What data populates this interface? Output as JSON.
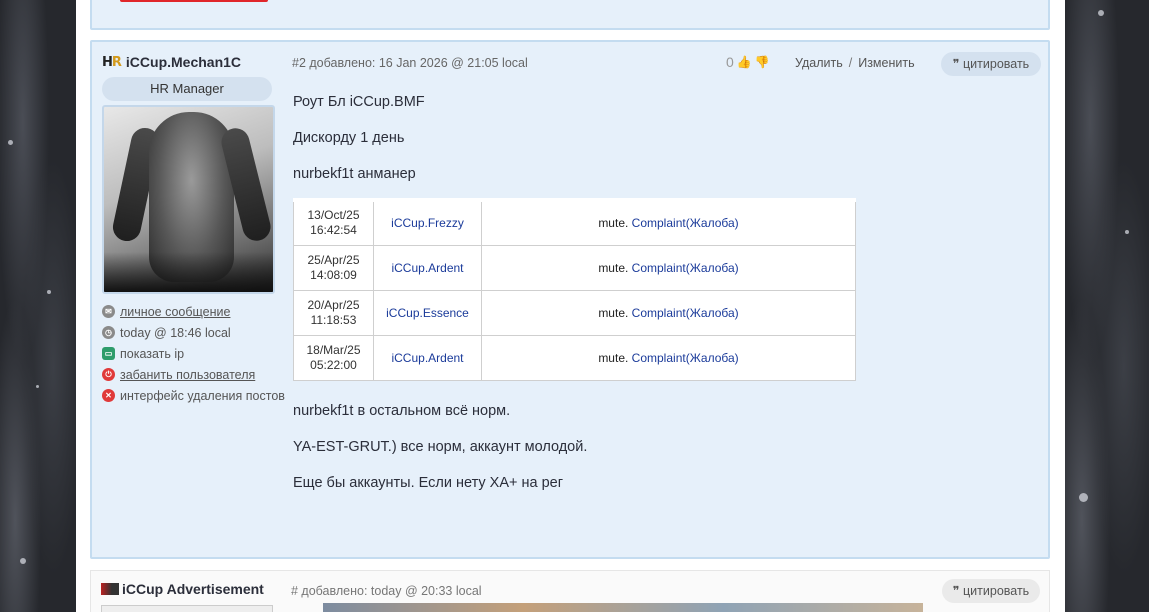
{
  "previous_post": {},
  "post": {
    "author": {
      "logo": "HR",
      "name": "iCCup.Mechan1C",
      "role": "HR Manager"
    },
    "actions": [
      {
        "icon": "envelope-icon",
        "label": "личное сообщение",
        "link": true,
        "color": "#8a8a8a"
      },
      {
        "icon": "clock-icon",
        "label": "today @ 18:46 local",
        "link": false,
        "color": "#8a8a8a"
      },
      {
        "icon": "monitor-icon",
        "label": "показать ip",
        "link": false,
        "color": "#2e9c6b"
      },
      {
        "icon": "power-icon",
        "label": "забанить пользователя",
        "link": true,
        "color": "#e03a3a"
      },
      {
        "icon": "close-circle-icon",
        "label": "интерфейс удаления постов",
        "link": false,
        "color": "#e03a3a"
      }
    ],
    "meta": "#2 добавлено: 16 Jan 2026 @ 21:05 local",
    "votes": "0",
    "admin": {
      "delete": "Удалить",
      "separator": "/",
      "edit": "Изменить"
    },
    "quote_label": "цитировать",
    "body_before": [
      "Роут Бл iCCup.BMF",
      "Дискорду 1 день",
      "nurbekf1t анманер"
    ],
    "log_table": [
      {
        "date": "13/Oct/25",
        "time": "16:42:54",
        "user": "iCCup.Frezzy",
        "reason": "mute.",
        "link": "Complaint(Жалоба)"
      },
      {
        "date": "25/Apr/25",
        "time": "14:08:09",
        "user": "iCCup.Ardent",
        "reason": "mute.",
        "link": "Complaint(Жалоба)"
      },
      {
        "date": "20/Apr/25",
        "time": "11:18:53",
        "user": "iCCup.Essence",
        "reason": "mute.",
        "link": "Complaint(Жалоба)"
      },
      {
        "date": "18/Mar/25",
        "time": "05:22:00",
        "user": "iCCup.Ardent",
        "reason": "mute.",
        "link": "Complaint(Жалоба)"
      }
    ],
    "body_after": [
      "nurbekf1t в остальном всё норм.",
      "YA-EST-GRUT.) все норм, аккаунт молодой.",
      "Еще бы аккаунты. Если нету ХА+ на рег"
    ]
  },
  "next_post": {
    "author_name": "iCCup Advertisement",
    "meta": "# добавлено: today @ 20:33 local",
    "quote_label": "цитировать"
  }
}
